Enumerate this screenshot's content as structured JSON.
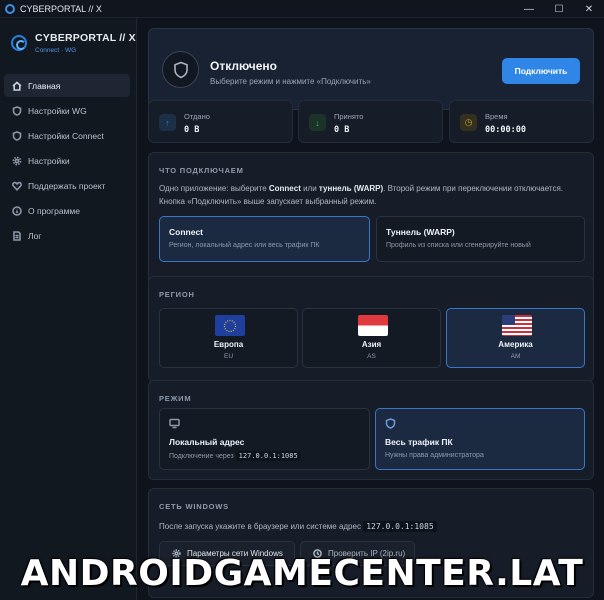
{
  "window": {
    "title": "CYBERPORTAL // X",
    "controls": [
      "—",
      "☐",
      "✕"
    ]
  },
  "brand": {
    "title": "CYBERPORTAL // X",
    "subtitle": "Connect · WG",
    "accent": "#2f86e6"
  },
  "sidebar": {
    "items": [
      {
        "label": "Главная",
        "icon": "home-icon",
        "active": true
      },
      {
        "label": "Настройки WG",
        "icon": "shield-icon"
      },
      {
        "label": "Настройки Connect",
        "icon": "shield-icon"
      },
      {
        "label": "Настройки",
        "icon": "gear-icon"
      },
      {
        "label": "Поддержать проект",
        "icon": "heart-icon"
      },
      {
        "label": "О программе",
        "icon": "info-icon"
      },
      {
        "label": "Лог",
        "icon": "log-icon"
      }
    ]
  },
  "status": {
    "title": "Отключено",
    "subtitle": "Выберите режим и нажмите «Подключить»",
    "button": "Подключить"
  },
  "stats": [
    {
      "label": "Отдано",
      "value": "0 B",
      "icon": "arrow-up-icon",
      "color": "#3a7fd6"
    },
    {
      "label": "Принято",
      "value": "0 B",
      "icon": "arrow-down-icon",
      "color": "#3fb56e"
    },
    {
      "label": "Время",
      "value": "00:00:00",
      "icon": "clock-icon",
      "color": "#c9a23a"
    }
  ],
  "what": {
    "title": "ЧТО ПОДКЛЮЧАЕМ",
    "text_a": "Одно приложение: выберите ",
    "text_b": "Connect",
    "text_c": " или ",
    "text_d": "туннель (WARP)",
    "text_e": ". Второй режим при переключении отключается. Кнопка «Подключить» выше запускает выбранный режим.",
    "options": [
      {
        "title": "Connect",
        "sub": "Регион, локальный адрес или весь трафик ПК",
        "selected": true
      },
      {
        "title": "Туннель (WARP)",
        "sub": "Профиль из списка или сгенерируйте новый",
        "selected": false
      }
    ]
  },
  "region": {
    "title": "РЕГИОН",
    "items": [
      {
        "name": "Европа",
        "code": "EU",
        "flag": "eu-flag-icon",
        "selected": false
      },
      {
        "name": "Азия",
        "code": "AS",
        "flag": "sg-flag-icon",
        "selected": false
      },
      {
        "name": "Америка",
        "code": "AM",
        "flag": "us-flag-icon",
        "selected": true
      }
    ]
  },
  "mode": {
    "title": "РЕЖИМ",
    "local": {
      "title": "Локальный адрес",
      "sub": "Подключение через",
      "addr": "127.0.0.1:1085"
    },
    "all": {
      "title": "Весь трафик ПК",
      "sub": "Нужны права администратора"
    }
  },
  "network": {
    "title": "СЕТЬ WINDOWS",
    "text": "После запуска укажите в браузере или системе адрес",
    "addr": "127.0.0.1:1085",
    "btn_settings": "Параметры сети Windows",
    "btn_check": "Проверить IP (2ip.ru)"
  },
  "watermark": "ANDROIDGAMECENTER.LAT"
}
